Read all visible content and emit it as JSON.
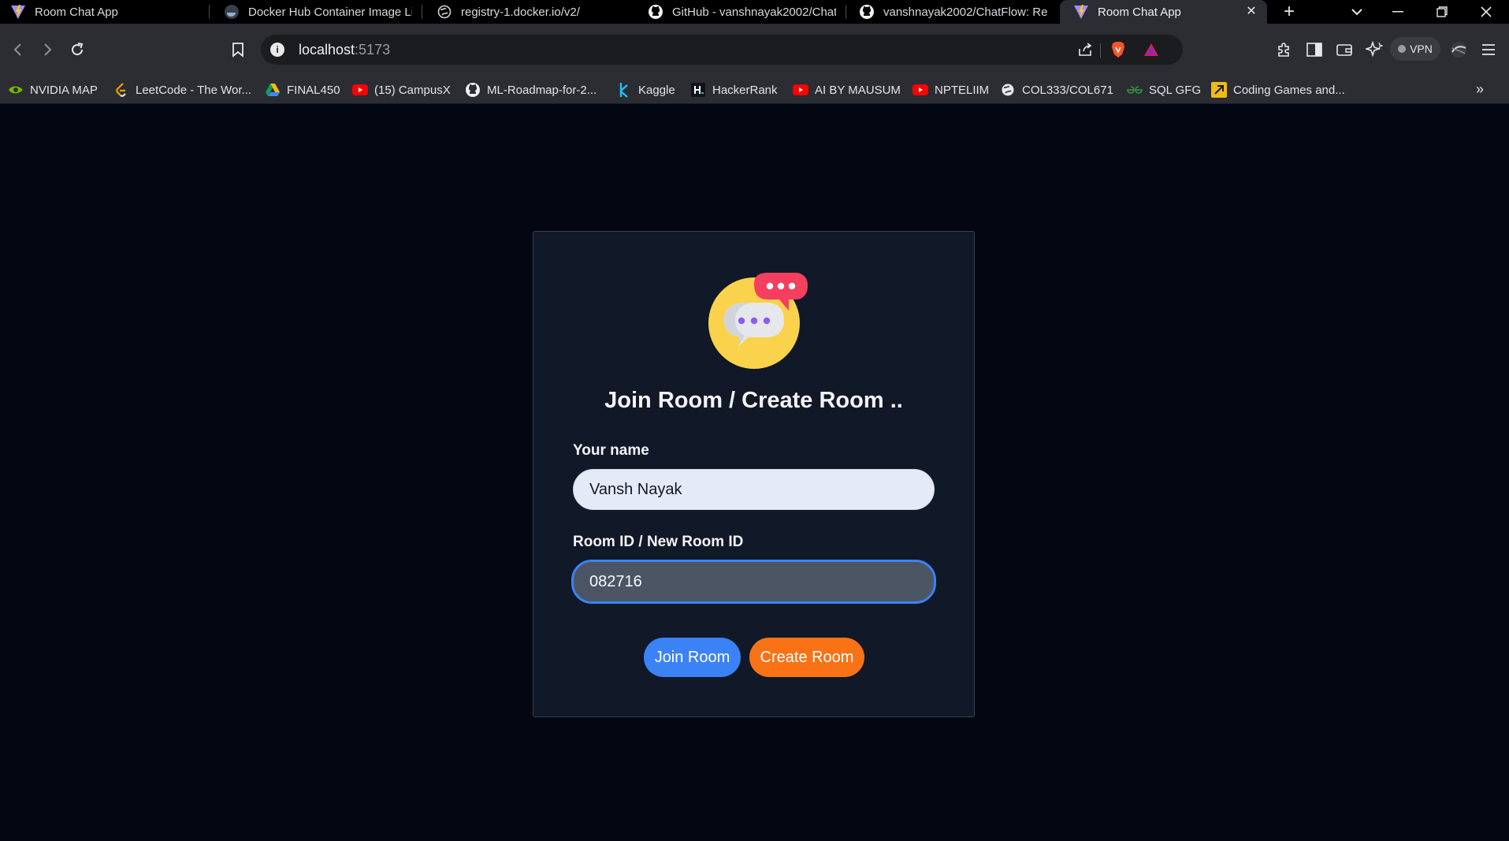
{
  "tabs": [
    {
      "title": "Room Chat App",
      "icon": "vite-icon",
      "active": false
    },
    {
      "title": "Docker Hub Container Image Li",
      "icon": "docker-icon",
      "active": false
    },
    {
      "title": "registry-1.docker.io/v2/",
      "icon": "globe-icon",
      "active": false
    },
    {
      "title": "GitHub - vanshnayak2002/Chat",
      "icon": "github-icon",
      "active": false
    },
    {
      "title": "vanshnayak2002/ChatFlow: Rea",
      "icon": "github-icon",
      "active": false
    },
    {
      "title": "Room Chat App",
      "icon": "vite-icon",
      "active": true
    }
  ],
  "toolbar": {
    "url_host": "localhost",
    "url_port": ":5173",
    "vpn_label": "VPN"
  },
  "bookmarks": [
    {
      "label": "NVIDIA MAP",
      "icon": "nvidia-icon"
    },
    {
      "label": "LeetCode - The Wor...",
      "icon": "leetcode-icon"
    },
    {
      "label": "FINAL450",
      "icon": "google-drive-icon"
    },
    {
      "label": "(15) CampusX",
      "icon": "youtube-icon"
    },
    {
      "label": "ML-Roadmap-for-2...",
      "icon": "github-icon"
    },
    {
      "label": "Kaggle",
      "icon": "kaggle-icon"
    },
    {
      "label": "HackerRank",
      "icon": "hackerrank-icon"
    },
    {
      "label": "AI BY MAUSUM",
      "icon": "youtube-icon"
    },
    {
      "label": "NPTELIIM",
      "icon": "youtube-icon"
    },
    {
      "label": "COL333/COL671",
      "icon": "globe-icon"
    },
    {
      "label": "SQL GFG",
      "icon": "gfg-icon"
    },
    {
      "label": "Coding Games and...",
      "icon": "codingame-icon"
    }
  ],
  "page": {
    "title": "Join Room / Create Room ..",
    "name_label": "Your name",
    "name_value": "Vansh Nayak",
    "room_label": "Room ID / New Room ID",
    "room_value": "082716",
    "join_label": "Join Room",
    "create_label": "Create Room"
  },
  "colors": {
    "page_bg": "#030712",
    "card_bg": "#111827",
    "join_button": "#3b82f6",
    "create_button": "#f97316",
    "focus_ring": "#3b82f6"
  }
}
